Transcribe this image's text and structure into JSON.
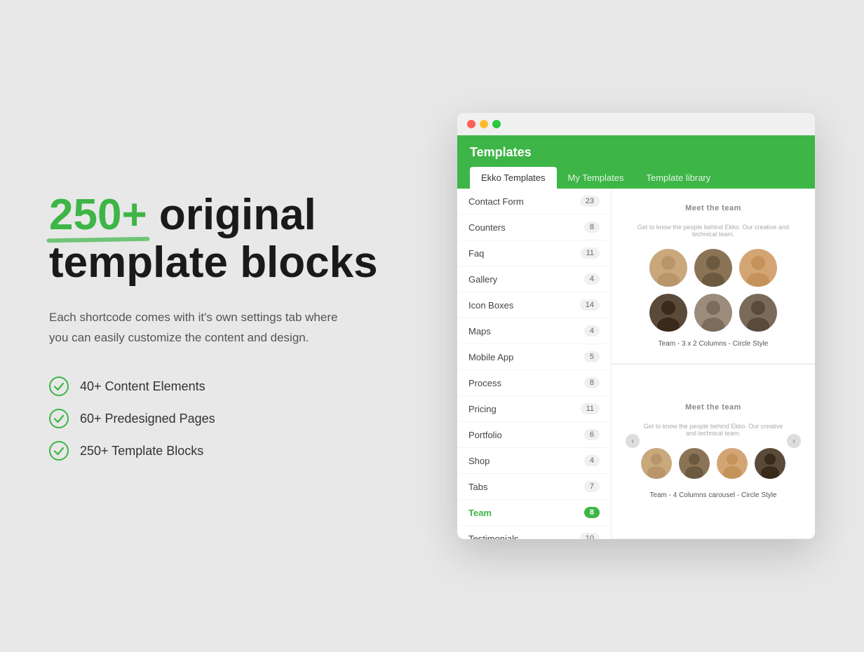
{
  "left": {
    "headline_number": "250+",
    "headline_text": " original template blocks",
    "subtitle": "Each shortcode comes with it's own settings tab where you can easily customize the content and design.",
    "features": [
      {
        "id": "f1",
        "text": "40+ Content Elements"
      },
      {
        "id": "f2",
        "text": "60+ Predesigned Pages"
      },
      {
        "id": "f3",
        "text": "250+ Template Blocks"
      }
    ]
  },
  "app": {
    "titlebar": {
      "dot1": "red",
      "dot2": "yellow",
      "dot3": "green"
    },
    "header": {
      "title": "Templates",
      "tabs": [
        {
          "id": "ekko",
          "label": "Ekko Templates",
          "active": true
        },
        {
          "id": "my",
          "label": "My Templates",
          "active": false
        },
        {
          "id": "library",
          "label": "Template library",
          "active": false
        }
      ]
    },
    "template_list": [
      {
        "id": "contact",
        "label": "Contact Form",
        "count": 23,
        "active": false
      },
      {
        "id": "counters",
        "label": "Counters",
        "count": 8,
        "active": false
      },
      {
        "id": "faq",
        "label": "Faq",
        "count": 11,
        "active": false
      },
      {
        "id": "gallery",
        "label": "Gallery",
        "count": 4,
        "active": false
      },
      {
        "id": "iconboxes",
        "label": "Icon Boxes",
        "count": 14,
        "active": false
      },
      {
        "id": "maps",
        "label": "Maps",
        "count": 4,
        "active": false
      },
      {
        "id": "mobileapp",
        "label": "Mobile App",
        "count": 5,
        "active": false
      },
      {
        "id": "process",
        "label": "Process",
        "count": 8,
        "active": false
      },
      {
        "id": "pricing",
        "label": "Pricing",
        "count": 11,
        "active": false
      },
      {
        "id": "portfolio",
        "label": "Portfolio",
        "count": 6,
        "active": false
      },
      {
        "id": "shop",
        "label": "Shop",
        "count": 4,
        "active": false
      },
      {
        "id": "tabs",
        "label": "Tabs",
        "count": 7,
        "active": false
      },
      {
        "id": "team",
        "label": "Team",
        "count": 8,
        "active": true
      },
      {
        "id": "testimonials",
        "label": "Testimonials",
        "count": 10,
        "active": false
      }
    ],
    "preview": {
      "card1": {
        "section_label": "Meet the team",
        "description": "Get to know the people behind Ekko. Our creative and technical team.",
        "label": "Team - 3 x 2 Columns - Circle Style"
      },
      "card2": {
        "section_label": "Meet the team",
        "description": "Get to know the people behind Ekko. Our creative and technical team.",
        "label": "Team - 4 Columns carousel - Circle Style"
      }
    }
  }
}
